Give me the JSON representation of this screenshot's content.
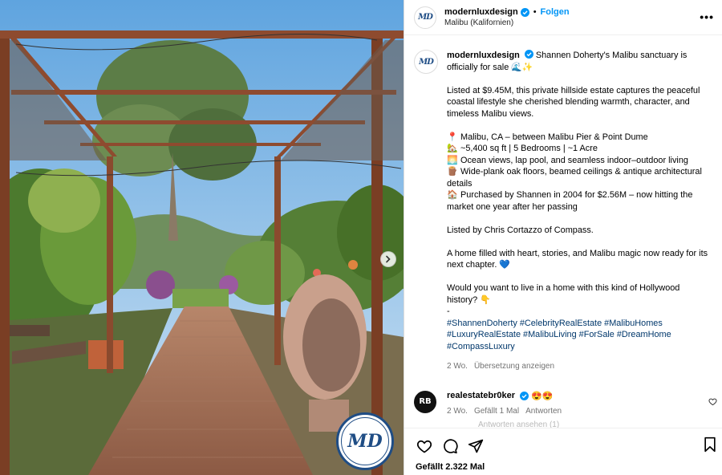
{
  "post": {
    "username": "modernluxdesign",
    "follow_label": "Folgen",
    "separator": "•",
    "location": "Malibu (Kalifornien)",
    "more_label": "•••",
    "avatar_text": "MD"
  },
  "caption": {
    "username": "modernluxdesign",
    "intro": "Shannen Doherty's Malibu sanctuary is officially for sale 🌊✨",
    "para1": "Listed at $9.45M, this private hillside estate captures the peaceful coastal lifestyle she cherished blending warmth, character, and timeless Malibu views.",
    "bullets": [
      {
        "icon": "📍",
        "text": "Malibu, CA – between Malibu Pier & Point Dume"
      },
      {
        "icon": "🏡",
        "text": "~5,400 sq ft | 5 Bedrooms | ~1 Acre"
      },
      {
        "icon": "🌅",
        "text": "Ocean views, lap pool, and seamless indoor–outdoor living"
      },
      {
        "icon": "🪵",
        "text": "Wide-plank oak floors, beamed ceilings & antique architectural details"
      },
      {
        "icon": "🏠",
        "text": "Purchased by Shannen in 2004 for $2.56M – now hitting the market one year after her passing"
      }
    ],
    "listed_by": "Listed by Chris Cortazzo of Compass.",
    "closing": "A home filled with heart, stories, and Malibu magic now ready for its next chapter. 💙",
    "question": "Would you want to live in a home with this kind of Hollywood history? 👇",
    "dash": "-",
    "hashtags": "#ShannenDoherty #CelebrityRealEstate #MalibuHomes #LuxuryRealEstate #MalibuLiving #ForSale #DreamHome #CompassLuxury",
    "time": "2 Wo.",
    "translate_label": "Übersetzung anzeigen"
  },
  "comment": {
    "username": "realestatebr0ker",
    "text": "😍😍",
    "avatar_text": "RB",
    "time": "2 Wo.",
    "likes": "Gefällt 1 Mal",
    "reply_label": "Antworten",
    "view_replies": "Antworten ansehen (1)"
  },
  "footer": {
    "likes_text": "Gefällt 2.322 Mal"
  },
  "watermark": {
    "text": "MD"
  },
  "colors": {
    "accent": "#0095f6",
    "hashtag": "#00376b",
    "brand_navy": "#1f4d85",
    "muted": "#737373"
  },
  "icons": [
    "verified-badge-icon",
    "more-icon",
    "heart-icon",
    "comment-icon",
    "share-icon",
    "bookmark-icon",
    "chevron-right-icon"
  ]
}
